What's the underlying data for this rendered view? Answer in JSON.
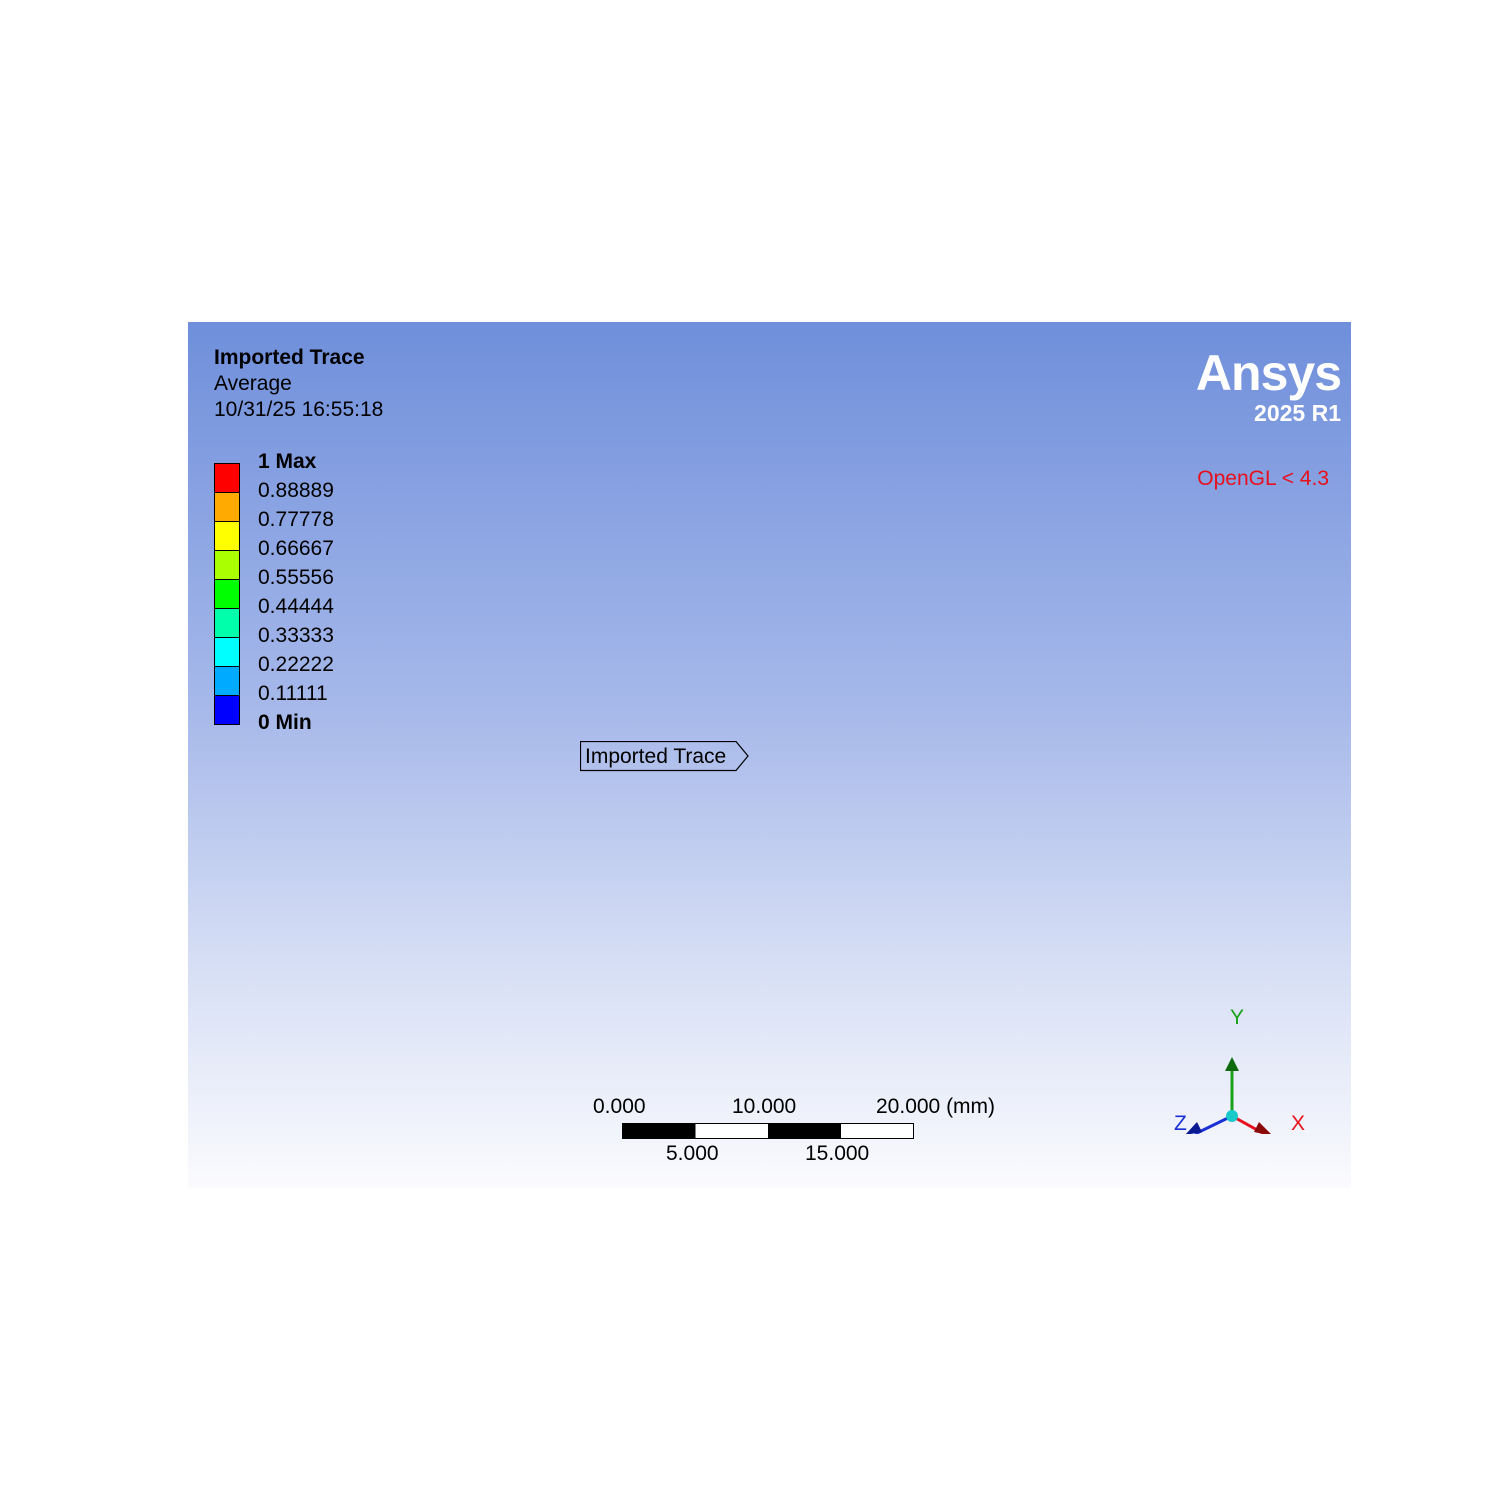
{
  "result": {
    "title": "Imported Trace",
    "subtitle": "Average",
    "timestamp": "10/31/25 16:55:18"
  },
  "legend": {
    "labels": [
      "1 Max",
      "0.88889",
      "0.77778",
      "0.66667",
      "0.55556",
      "0.44444",
      "0.33333",
      "0.22222",
      "0.11111",
      "0 Min"
    ],
    "colors": [
      "#ff0000",
      "#ffaa00",
      "#ffff00",
      "#aaff00",
      "#00ff00",
      "#00ffaa",
      "#00ffff",
      "#00aaff",
      "#0000ff"
    ]
  },
  "logo": {
    "name": "Ansys",
    "version": "2025 R1"
  },
  "renderer_warning": "OpenGL < 4.3",
  "annotation": {
    "label": "Imported Trace"
  },
  "scale": {
    "top_labels": [
      "0.000",
      "10.000",
      "20.000 (mm)"
    ],
    "bottom_labels": [
      "5.000",
      "15.000"
    ]
  },
  "triad": {
    "x": "X",
    "y": "Y",
    "z": "Z",
    "colors": {
      "x": "#e8101c",
      "y": "#1aa31a",
      "z": "#1b2fd6"
    }
  }
}
